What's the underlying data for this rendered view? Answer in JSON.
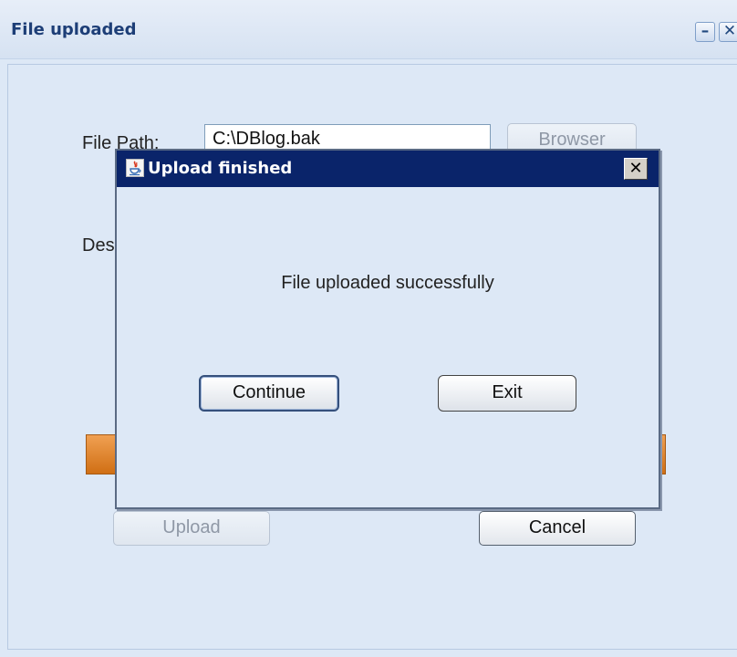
{
  "window": {
    "title": "File uploaded"
  },
  "form": {
    "file_path_label": "File Path:",
    "file_path_value": "C:\\DBlog.bak",
    "browse_label": "Browser",
    "description_label": "Des",
    "upload_label": "Upload",
    "cancel_label": "Cancel"
  },
  "dialog": {
    "title": "Upload finished",
    "close_glyph": "✕",
    "message": "File uploaded successfully",
    "continue_label": "Continue",
    "exit_label": "Exit"
  },
  "icons": {
    "minimize": "minimize-icon",
    "close": "close-icon",
    "java": "java-icon"
  },
  "colors": {
    "dialog_title_bg": "#0a246a",
    "accent_orange": "#e07f22",
    "panel_bg": "#dde8f6"
  }
}
